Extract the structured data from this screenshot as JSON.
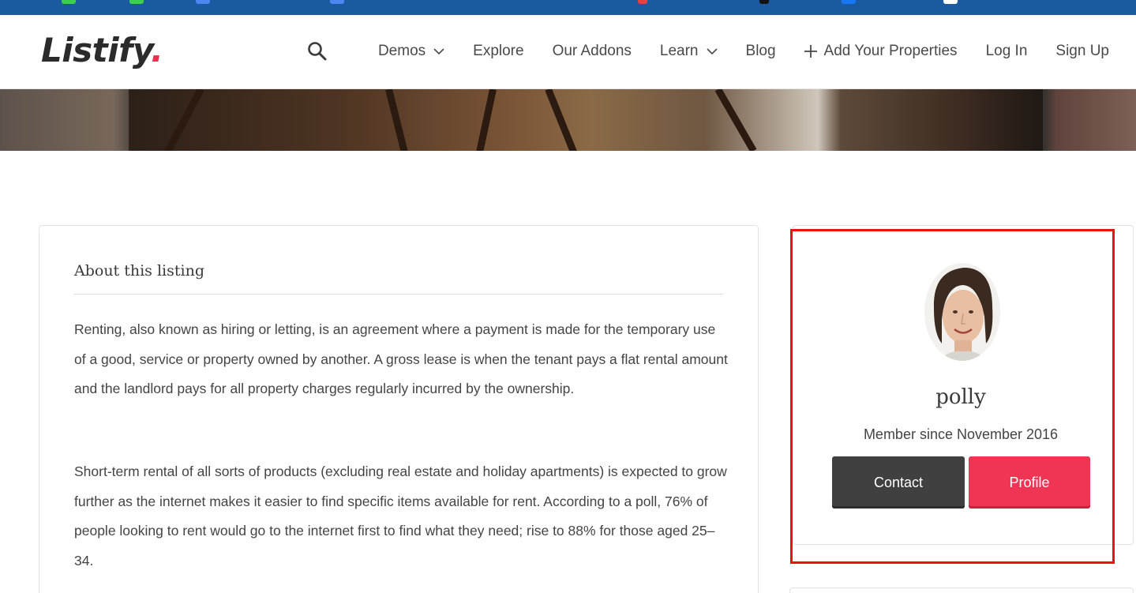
{
  "colors": {
    "browser_bar": "#1a5aa0",
    "accent": "#e8304f",
    "contact_button": "#404040",
    "profile_button": "#ef3553",
    "highlight_box": "#ee1111"
  },
  "header": {
    "logo_text": "Listify",
    "logo_dot": ".",
    "search_icon": "search-icon",
    "nav": [
      {
        "label": "Demos",
        "has_dropdown": true
      },
      {
        "label": "Explore",
        "has_dropdown": false
      },
      {
        "label": "Our Addons",
        "has_dropdown": false
      },
      {
        "label": "Learn",
        "has_dropdown": true
      },
      {
        "label": "Blog",
        "has_dropdown": false
      },
      {
        "label": "Add Your Properties",
        "icon": "plus-icon"
      },
      {
        "label": "Log In"
      },
      {
        "label": "Sign Up"
      }
    ]
  },
  "listing": {
    "section_title": "About this listing",
    "paragraphs": [
      "Renting, also known as hiring or letting, is an agreement where a payment is made for the tem­porary use of a good, service or property owned by another. A gross lease is when the tenant pays a flat rental amount and the landlord pays for all property charges regularly incurred by the ownership.",
      "Short-term rental of all sorts of products (excluding real estate and holiday apartments) is ex­pected to grow further as the internet makes it easier to find specific items available for rent. According to a poll, 76% of people looking to rent would go to the internet first to find what they need; rise to 88% for those aged 25–34."
    ]
  },
  "author": {
    "name": "polly",
    "member_since": "Member since November 2016",
    "contact_label": "Contact",
    "profile_label": "Profile"
  }
}
